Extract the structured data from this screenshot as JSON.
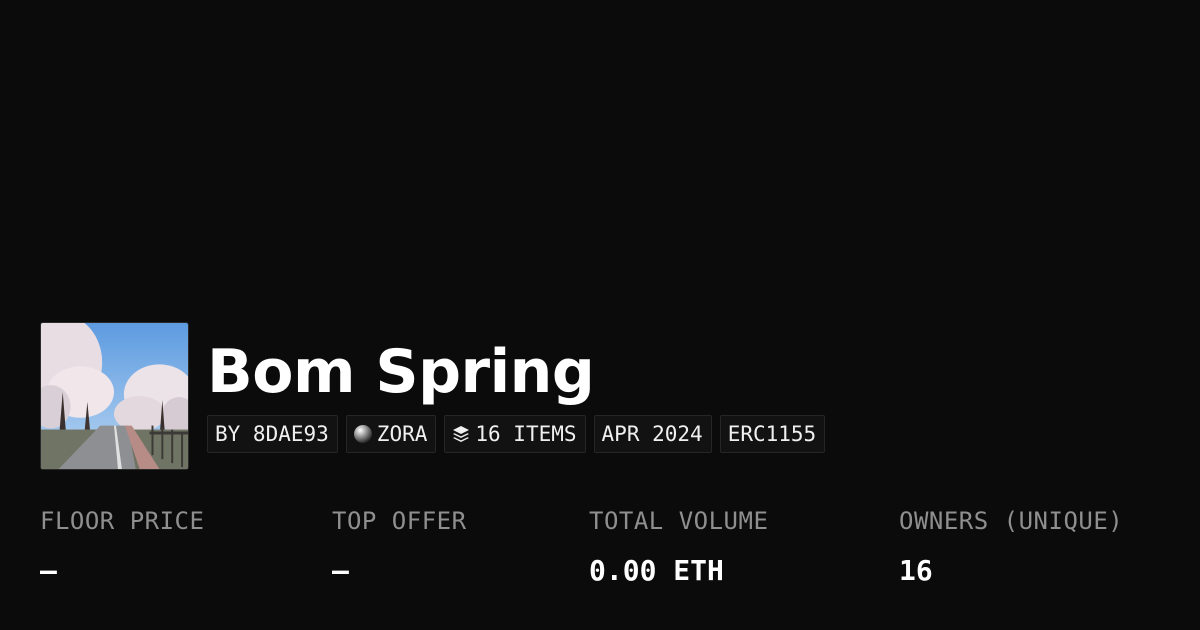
{
  "collection": {
    "title": "Bom Spring",
    "thumbnail_icon": "cherry-blossom-road-photo"
  },
  "tags": {
    "creator": "BY 8DAE93",
    "chain": "ZORA",
    "chain_icon": "zora-orb-icon",
    "items": "16 ITEMS",
    "items_icon": "layers-icon",
    "date": "APR 2024",
    "standard": "ERC1155"
  },
  "stats": {
    "floor_price": {
      "label": "FLOOR PRICE",
      "value": "–"
    },
    "top_offer": {
      "label": "TOP OFFER",
      "value": "–"
    },
    "total_volume": {
      "label": "TOTAL VOLUME",
      "value": "0.00 ETH"
    },
    "owners": {
      "label": "OWNERS (UNIQUE)",
      "value": "16"
    }
  },
  "colors": {
    "background": "#0b0b0b",
    "text": "#ffffff",
    "muted": "#8f8f8f",
    "tag_border": "#262626"
  }
}
